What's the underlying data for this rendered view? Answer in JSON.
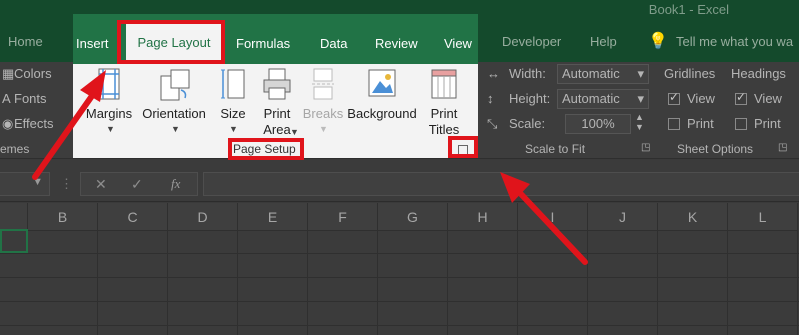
{
  "window": {
    "title": "Book1 - Excel"
  },
  "tabs": {
    "home": "Home",
    "insert": "Insert",
    "page_layout": "Page Layout",
    "formulas": "Formulas",
    "data": "Data",
    "review": "Review",
    "view": "View",
    "developer": "Developer",
    "help": "Help",
    "tell_me": "Tell me what you wa"
  },
  "themes_group": {
    "colors": "Colors",
    "fonts": "Fonts",
    "effects": "Effects",
    "label": "emes"
  },
  "page_setup": {
    "margins": "Margins",
    "orientation": "Orientation",
    "size": "Size",
    "print_area_1": "Print",
    "print_area_2": "Area",
    "breaks": "Breaks",
    "background": "Background",
    "print_titles_1": "Print",
    "print_titles_2": "Titles",
    "group_label": "Page Setup"
  },
  "scale_to_fit": {
    "width_label": "Width:",
    "width_value": "Automatic",
    "height_label": "Height:",
    "height_value": "Automatic",
    "scale_label": "Scale:",
    "scale_value": "100%",
    "group_label": "Scale to Fit"
  },
  "sheet_options": {
    "gridlines": "Gridlines",
    "headings": "Headings",
    "view": "View",
    "print": "Print",
    "group_label": "Sheet Options"
  },
  "formula_bar": {
    "fx": "fx"
  },
  "columns": [
    "B",
    "C",
    "D",
    "E",
    "F",
    "G",
    "H",
    "I",
    "J",
    "K",
    "L"
  ],
  "colors": {
    "excel_green": "#217346",
    "annotation_red": "#e0141b"
  }
}
